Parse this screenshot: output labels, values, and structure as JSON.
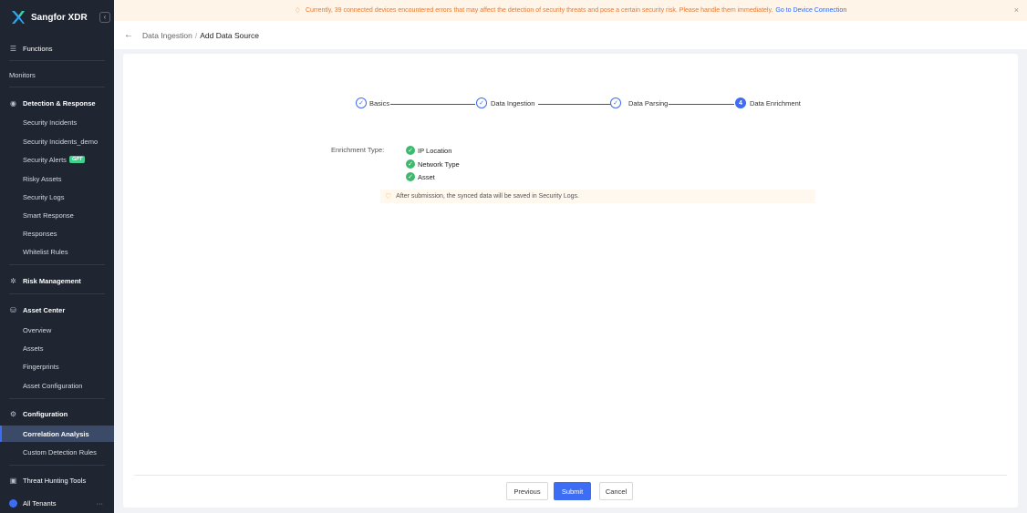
{
  "app": {
    "name": "Sangfor XDR",
    "collapse_icon": "collapse-left-icon"
  },
  "sidebar": {
    "functions": "Functions",
    "monitors": "Monitors",
    "detection_group": "Detection & Response",
    "detection_items": [
      "Security Incidents",
      "Security Incidents_demo",
      "Security Alerts",
      "Risky Assets",
      "Security Logs",
      "Smart Response",
      "Responses",
      "Whitelist Rules"
    ],
    "gpt_badge": "GPT",
    "risk_group": "Risk Management",
    "asset_group": "Asset Center",
    "asset_items": [
      "Overview",
      "Assets",
      "Fingerprints",
      "Asset Configuration"
    ],
    "config_group": "Configuration",
    "config_items": [
      "Correlation Analysis",
      "Custom Detection Rules"
    ],
    "active_item": "Correlation Analysis",
    "threat_hunting": "Threat Hunting Tools",
    "tenants": "All Tenants",
    "tenants_more": "···"
  },
  "banner": {
    "message": "Currently, 39 connected devices encountered errors that may affect the detection of security threats and pose a certain security risk. Please handle them immediately.",
    "link": "Go to Device Connection",
    "close": "×"
  },
  "header": {
    "back_icon": "arrow-left-icon",
    "breadcrumb_parent": "Data Ingestion",
    "separator": "/",
    "breadcrumb_current": "Add Data Source"
  },
  "steps": [
    {
      "label": "Basics",
      "status": "done"
    },
    {
      "label": "Data Ingestion",
      "status": "done"
    },
    {
      "label": "Data Parsing",
      "status": "done"
    },
    {
      "label": "Data Enrichment",
      "status": "current",
      "number": "4"
    }
  ],
  "enrichment": {
    "label": "Enrichment Type:",
    "items": [
      "IP Location",
      "Network Type",
      "Asset"
    ],
    "notice": "After submission, the synced data will be saved in Security Logs."
  },
  "footer": {
    "previous": "Previous",
    "submit": "Submit",
    "cancel": "Cancel"
  },
  "colors": {
    "primary": "#3d6df5",
    "sidebar_bg": "#1f2531",
    "success": "#3cb96d",
    "warning": "#e8772e"
  }
}
